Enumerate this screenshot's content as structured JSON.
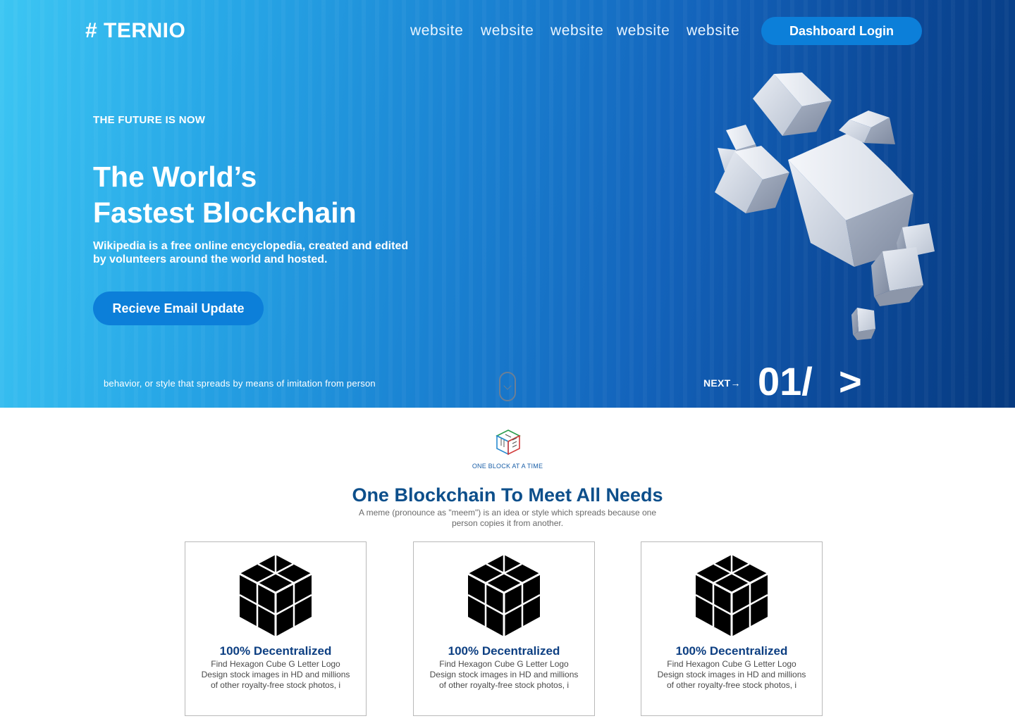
{
  "header": {
    "logo": "# TERNIO",
    "nav": [
      "website",
      "website",
      "website",
      "website",
      "website"
    ],
    "login_label": "Dashboard Login"
  },
  "hero": {
    "kicker": "THE FUTURE IS NOW",
    "headline_line1": "The World’s",
    "headline_line2": "Fastest Blockchain",
    "subtitle": "Wikipedia is a free online encyclopedia, created and edited by volunteers around the world and hosted.",
    "cta_label": "Recieve Email Update",
    "footnote": "behavior, or style that spreads by means of imitation from person",
    "next_label": "NEXT",
    "next_arrow": "→",
    "slide_number": "01/",
    "slide_arrow": ">"
  },
  "section": {
    "tagline": "ONE BLOCK AT A TIME",
    "title": "One Blockchain To Meet All Needs",
    "description": "A meme (pronounce as \"meem\") is an idea or style which spreads because one person copies it from another."
  },
  "cards": [
    {
      "icon": "cube-icon",
      "title": "100% Decentralized",
      "description": "Find Hexagon Cube G Letter Logo Design stock images in HD and millions of other royalty-free stock photos, i"
    },
    {
      "icon": "cube-icon",
      "title": "100% Decentralized",
      "description": "Find Hexagon Cube G Letter Logo Design stock images in HD and millions of other royalty-free stock photos, i"
    },
    {
      "icon": "cube-icon",
      "title": "100% Decentralized",
      "description": "Find Hexagon Cube G Letter Logo Design stock images in HD and millions of other royalty-free stock photos, i"
    }
  ],
  "colors": {
    "accent": "#0c7fd9",
    "title_blue": "#0d4f8b",
    "card_title": "#0d3f82",
    "hero_gradient_start": "#3cc6f3",
    "hero_gradient_end": "#063a80"
  }
}
